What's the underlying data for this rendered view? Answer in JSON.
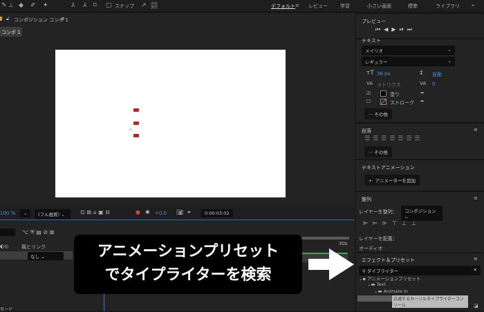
{
  "toolbar": {
    "snap_label": "スナップ"
  },
  "workspaces": [
    "デフォルト",
    "レビュー",
    "学習",
    "小さい画面",
    "標準",
    "ライブラリ"
  ],
  "composition": {
    "panel_title": "コンポジション コンポ 1",
    "tab": "コンポ 1"
  },
  "viewer": {
    "zoom": "100 %",
    "quality": "(フル画質)",
    "exposure": "+0.0",
    "timecode": "0:00:03:02"
  },
  "timeline": {
    "column_parent": "親とリンク",
    "parent_value": "なし",
    "end_label": "30s",
    "bottom_label": "モード"
  },
  "preview": {
    "title": "プレビュー"
  },
  "text_panel": {
    "title": "テキスト",
    "font": "メイリオ",
    "style": "レギュラー",
    "size": "36 px",
    "leading": "自動",
    "kerning": "メトリクス",
    "tracking": "0",
    "fill": "塗り",
    "stroke": "ストローク",
    "more": "その他"
  },
  "paragraph": {
    "title": "段落",
    "more": "その他"
  },
  "text_animation": {
    "title": "テキストアニメーション",
    "add": "アニメーターを追加"
  },
  "align": {
    "title": "整列",
    "align_to_label": "レイヤーを整列：",
    "align_to_value": "コンポジション",
    "distribute_label": "レイヤーを配置：",
    "audio": "オーディオ"
  },
  "effects": {
    "title": "エフェクト＆プリセット",
    "search": "タイプライター",
    "tree": [
      "アニメーションプリセット",
      "Text",
      "Animate In",
      "点滅するカーソルタイプライターコンソール"
    ]
  },
  "caption": {
    "line1": "アニメーションプリセット",
    "line2": "でタイプライターを検索"
  },
  "colors": {
    "accent": "#2e66b8",
    "keyframe": "#b3262b"
  }
}
